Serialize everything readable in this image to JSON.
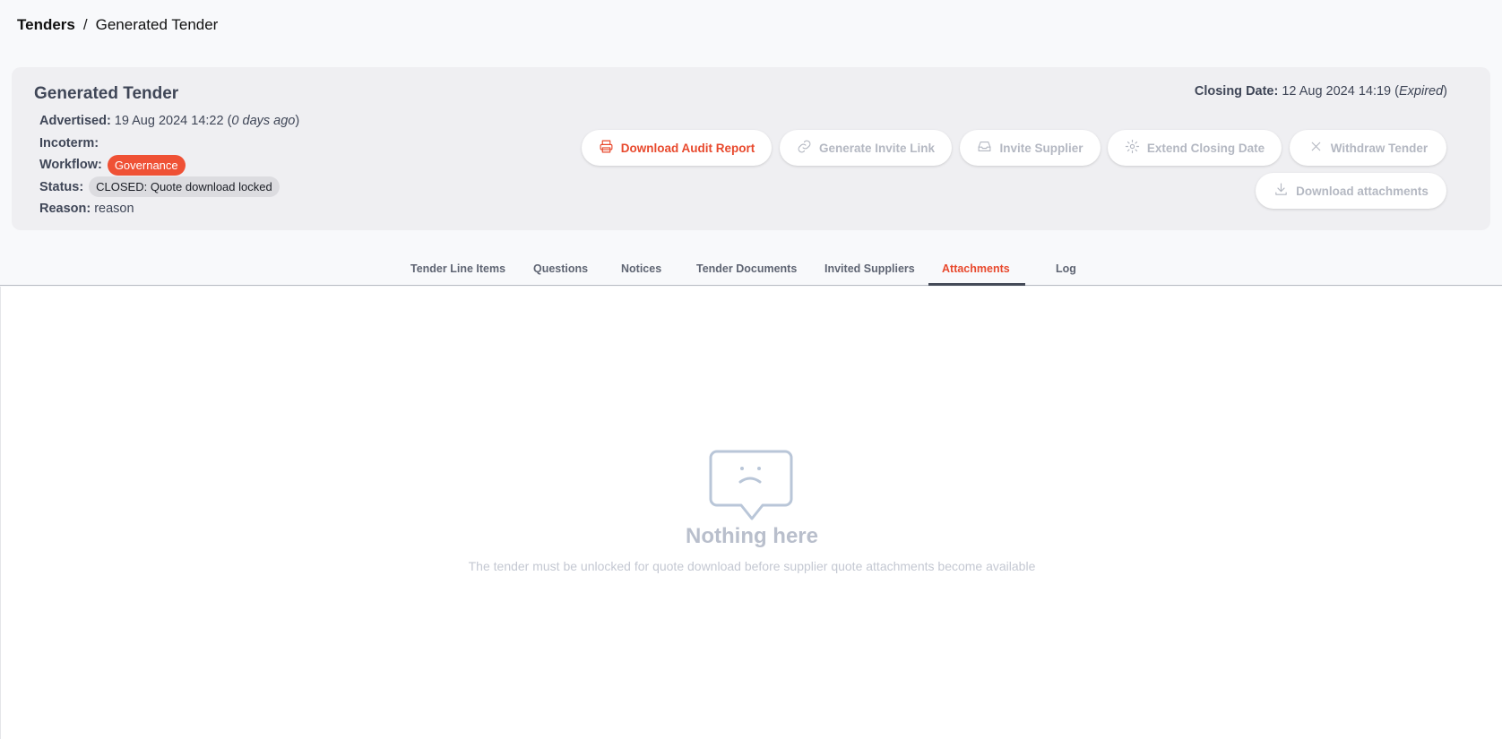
{
  "breadcrumb": {
    "root": "Tenders",
    "separator": "/",
    "current": "Generated Tender"
  },
  "tender": {
    "title": "Generated Tender",
    "advertised_label": "Advertised:",
    "advertised_value": "19 Aug 2024 14:22 (",
    "advertised_ago": "0 days ago",
    "advertised_close": ")",
    "incoterm_label": "Incoterm:",
    "incoterm_value": "",
    "workflow_label": "Workflow:",
    "workflow_value": "Governance",
    "status_label": "Status:",
    "status_value": "CLOSED: Quote download locked",
    "reason_label": "Reason:",
    "reason_value": "reason",
    "closing_label": "Closing Date:",
    "closing_value": "12 Aug 2024 14:19 (",
    "closing_expired": "Expired",
    "closing_close": ")"
  },
  "actions": {
    "download_audit": "Download Audit Report",
    "generate_invite": "Generate Invite Link",
    "invite_supplier": "Invite Supplier",
    "extend_closing": "Extend Closing Date",
    "withdraw": "Withdraw Tender",
    "download_attachments": "Download attachments"
  },
  "tabs": [
    {
      "label": "Tender Line Items"
    },
    {
      "label": "Questions"
    },
    {
      "label": "Notices"
    },
    {
      "label": "Tender Documents"
    },
    {
      "label": "Invited Suppliers"
    },
    {
      "label": "Attachments",
      "active": true
    },
    {
      "label": "Log"
    }
  ],
  "empty_state": {
    "icon": "sad-chat-bubble-icon",
    "title": "Nothing here",
    "description": "The tender must be unlocked for quote download before supplier quote attachments become available"
  },
  "colors": {
    "accent": "#e8492d",
    "governance_badge": "#ef5135",
    "muted": "#b4b8c2"
  }
}
